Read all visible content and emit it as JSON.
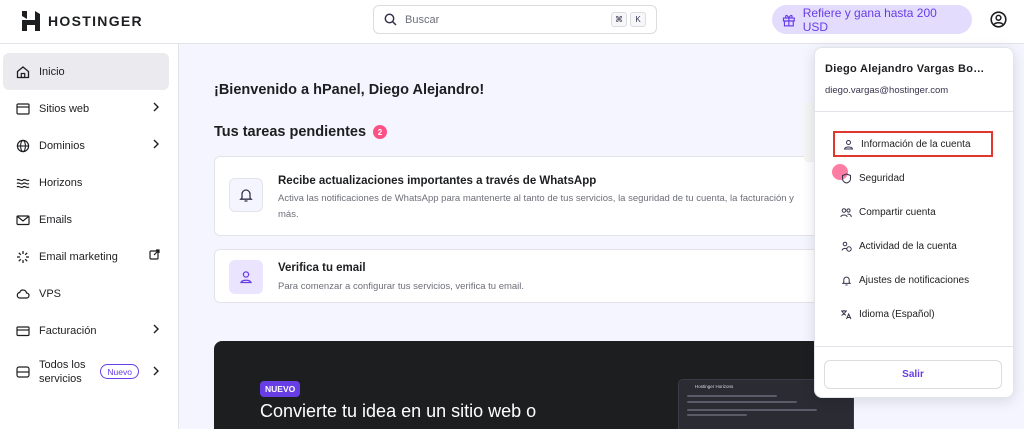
{
  "brand": {
    "name": "HOSTINGER"
  },
  "search": {
    "placeholder": "Buscar",
    "kbd1": "⌘",
    "kbd2": "K"
  },
  "refer": {
    "label": "Refiere y gana hasta 200 USD"
  },
  "sidebar": {
    "items": [
      {
        "label": "Inicio",
        "icon": "home-icon"
      },
      {
        "label": "Sitios web",
        "icon": "browser-icon"
      },
      {
        "label": "Dominios",
        "icon": "globe-icon"
      },
      {
        "label": "Horizons",
        "icon": "horizons-icon"
      },
      {
        "label": "Emails",
        "icon": "mail-icon"
      },
      {
        "label": "Email marketing",
        "icon": "sparkle-icon"
      },
      {
        "label": "VPS",
        "icon": "cloud-icon"
      },
      {
        "label": "Facturación",
        "icon": "card-icon"
      },
      {
        "label": "Todos los servicios",
        "icon": "services-icon",
        "badge": "Nuevo"
      }
    ]
  },
  "main": {
    "welcome": "¡Bienvenido a hPanel, Diego Alejandro!",
    "tasks_title": "Tus tareas pendientes",
    "tasks_count": "2",
    "cards": [
      {
        "title": "Recibe actualizaciones importantes a través de WhatsApp",
        "desc": "Activa las notificaciones de WhatsApp para mantenerte al tanto de tus servicios, la seguridad de tu cuenta, la facturación y más."
      },
      {
        "title": "Verifica tu email",
        "desc": "Para comenzar a configurar tus servicios, verifica tu email."
      }
    ],
    "promo": {
      "tag": "NUEVO",
      "title": "Convierte tu idea en un sitio web o",
      "mock_title": "Hostinger Horizons"
    }
  },
  "account_menu": {
    "name": "Diego Alejandro Vargas Bo…",
    "email": "diego.vargas@hostinger.com",
    "items": [
      {
        "label": "Información de la cuenta",
        "icon": "user-icon"
      },
      {
        "label": "Seguridad",
        "icon": "shield-icon"
      },
      {
        "label": "Compartir cuenta",
        "icon": "users-icon"
      },
      {
        "label": "Actividad de la cuenta",
        "icon": "activity-icon"
      },
      {
        "label": "Ajustes de notificaciones",
        "icon": "bell-icon"
      },
      {
        "label": "Idioma (Español)",
        "icon": "translate-icon"
      }
    ],
    "logout": "Salir"
  },
  "colors": {
    "accent": "#673de6",
    "highlight": "#e0372f",
    "badge": "#fc5185"
  }
}
